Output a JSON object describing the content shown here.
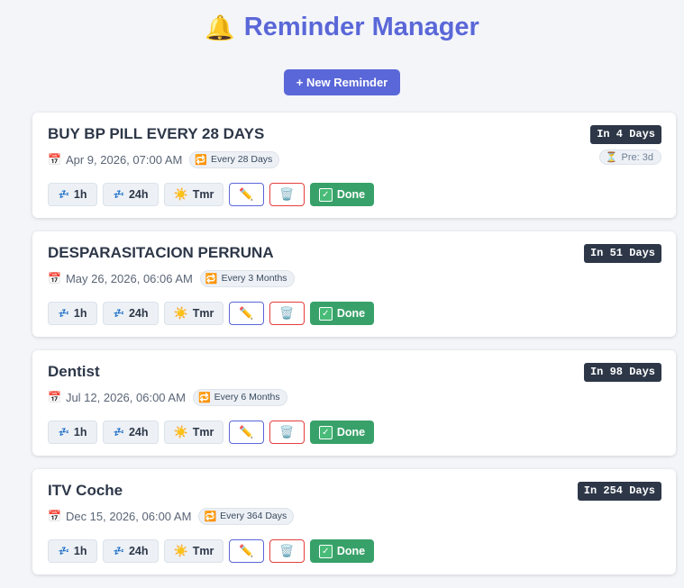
{
  "app": {
    "title": "Reminder Manager",
    "title_icon": "🔔",
    "new_button_label": "+ New Reminder"
  },
  "labels": {
    "snooze_1h": "1h",
    "snooze_24h": "24h",
    "snooze_tomorrow": "Tmr",
    "edit_icon": "✏️",
    "delete_icon": "🗑️",
    "done": "Done"
  },
  "reminders": [
    {
      "title": "BUY BP PILL EVERY 28 DAYS",
      "date": "Apr 9, 2026, 07:00 AM",
      "recurrence": "Every 28 Days",
      "countdown": "In 4 Days",
      "pre_notice": "Pre: 3d"
    },
    {
      "title": "DESPARASITACION PERRUNA",
      "date": "May 26, 2026, 06:06 AM",
      "recurrence": "Every 3 Months",
      "countdown": "In 51 Days"
    },
    {
      "title": "Dentist",
      "date": "Jul 12, 2026, 06:00 AM",
      "recurrence": "Every 6 Months",
      "countdown": "In 98 Days"
    },
    {
      "title": "ITV Coche",
      "date": "Dec 15, 2026, 06:00 AM",
      "recurrence": "Every 364 Days",
      "countdown": "In 254 Days"
    }
  ],
  "colors": {
    "accent": "#5a67d8",
    "done": "#38a169",
    "delete": "#e53e3e",
    "countdown_bg": "#2d3748"
  }
}
